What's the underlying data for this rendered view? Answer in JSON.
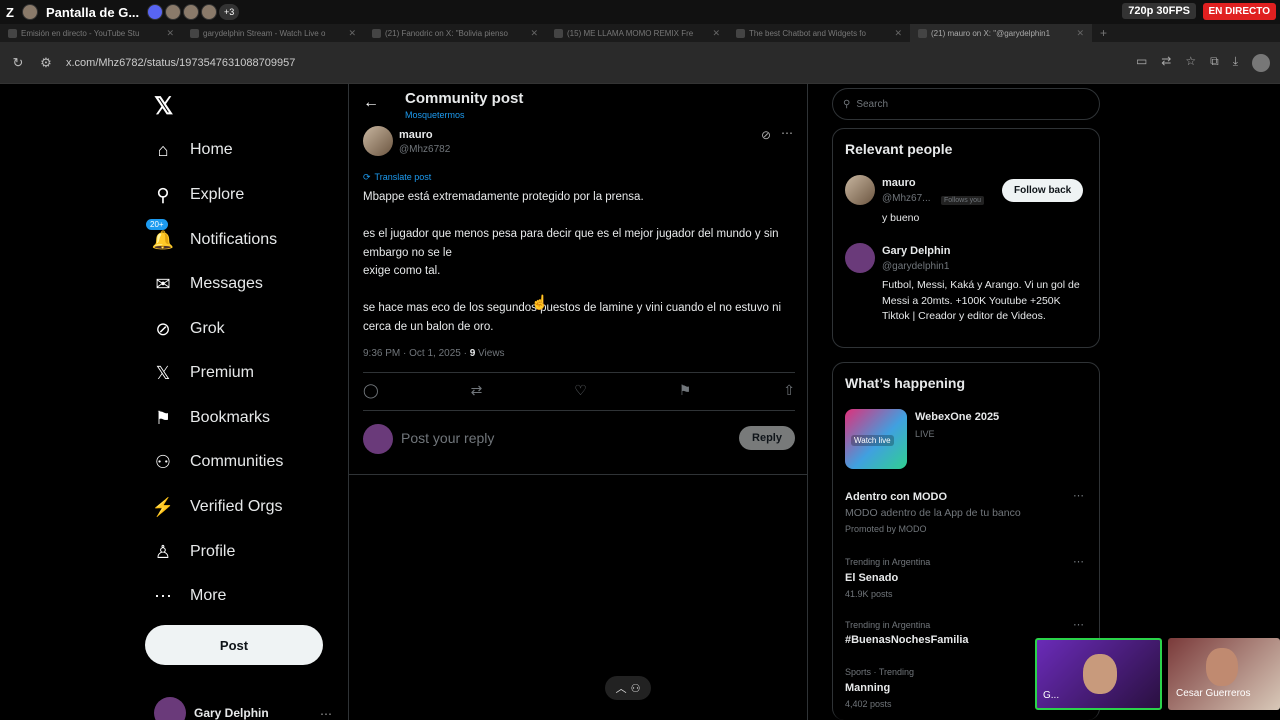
{
  "overlay": {
    "letter": "Z",
    "stream_title": "Pantalla de G...",
    "extra_count": "+3",
    "quality": "720p 30FPS",
    "live": "EN DIRECTO"
  },
  "browser": {
    "tabs": [
      {
        "label": "Emisión en directo - YouTube Stu"
      },
      {
        "label": "garydelphin Stream - Watch Live o"
      },
      {
        "label": "(21) Fanodric on X: \"Bolivia pienso"
      },
      {
        "label": "(15) ME LLAMA MOMO REMIX Fre"
      },
      {
        "label": "The best Chatbot and Widgets fo"
      },
      {
        "label": "(21) mauro on X: \"@garydelphin1"
      }
    ],
    "new_tab": "+",
    "url": "x.com/Mhz6782/status/1973547631088709957"
  },
  "nav": {
    "items": [
      {
        "label": "Home"
      },
      {
        "label": "Explore"
      },
      {
        "label": "Notifications"
      },
      {
        "label": "Messages"
      },
      {
        "label": "Grok"
      },
      {
        "label": "Premium"
      },
      {
        "label": "Bookmarks"
      },
      {
        "label": "Communities"
      },
      {
        "label": "Verified Orgs"
      },
      {
        "label": "Profile"
      },
      {
        "label": "More"
      }
    ],
    "notif_badge": "20+",
    "post_button": "Post",
    "account_name": "Gary Delphin"
  },
  "post": {
    "header_title": "Community post",
    "header_sub": "Mosquetermos",
    "author_name": "mauro",
    "author_handle": "@Mhz6782",
    "translate": "Translate post",
    "paragraphs": [
      "Mbappe está extremadamente protegido por la prensa.",
      "es el jugador que menos pesa para decir que es el mejor jugador del mundo y sin embargo no se le\nexige como tal.",
      "se hace mas eco de los segundos puestos de lamine y vini cuando el no estuvo ni cerca de un balon de oro."
    ],
    "time": "9:36 PM · Oct 1, 2025 · ",
    "views_count": "9",
    "views_label": " Views",
    "reply_placeholder": "Post your reply",
    "reply_button": "Reply"
  },
  "right": {
    "search_placeholder": "Search",
    "relevant_title": "Relevant people",
    "people": [
      {
        "name": "mauro",
        "handle": "@Mhz67...",
        "follows_you": "Follows you",
        "bio": "y bueno",
        "button": "Follow back"
      },
      {
        "name": "Gary Delphin",
        "handle": "@garydelphin1",
        "bio": "Futbol, Messi, Kaká y Arango. Vi un gol de Messi a 20mts. +100K Youtube +250K Tiktok | Creador y editor de Videos."
      }
    ],
    "happening_title": "What’s happening",
    "featured": {
      "title": "WebexOne 2025",
      "status": "LIVE",
      "thumb_text": "Watch live"
    },
    "trends": [
      {
        "label": "Adentro con MODO",
        "desc": "MODO adentro de la App de tu banco",
        "promo": "Promoted by MODO"
      },
      {
        "label": "Trending in Argentina",
        "title": "El Senado",
        "count": "41.9K posts"
      },
      {
        "label": "Trending in Argentina",
        "title": "#BuenasNochesFamilia"
      },
      {
        "label": "Sports · Trending",
        "title": "Manning",
        "count": "4,402 posts"
      }
    ]
  },
  "webcams": {
    "cam1_label": "G...",
    "cam2_label": "Cesar Guerreros"
  }
}
